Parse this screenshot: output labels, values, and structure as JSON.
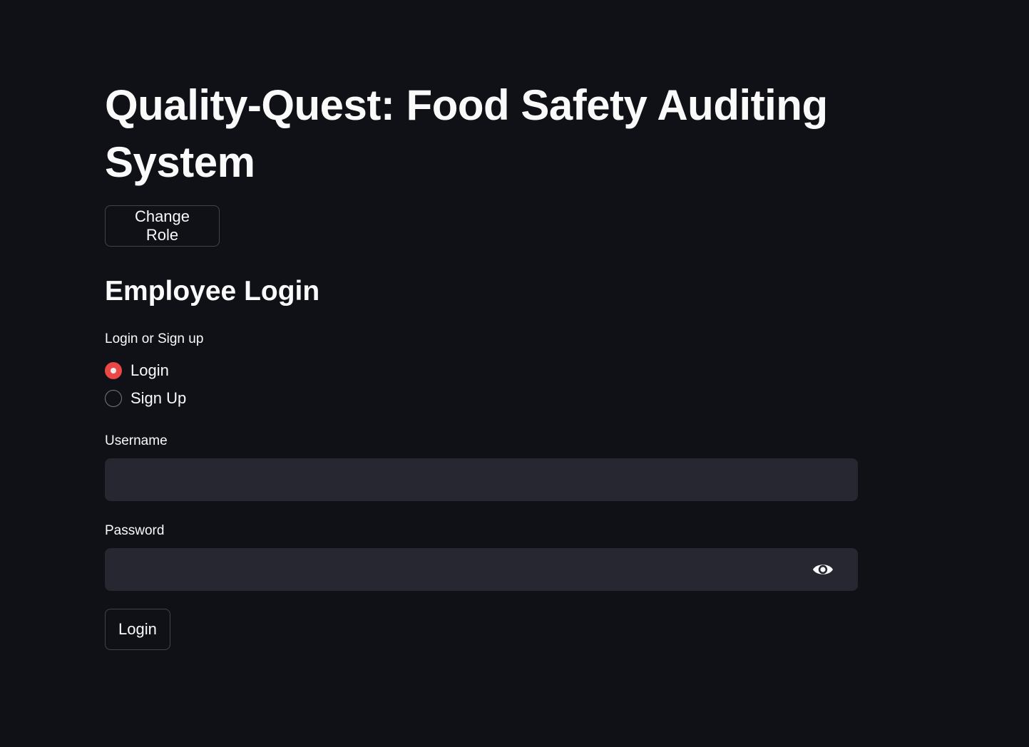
{
  "page": {
    "title": "Quality-Quest: Food Safety Auditing System",
    "change_role_label": "Change Role",
    "subheader": "Employee Login"
  },
  "auth_mode": {
    "label": "Login or Sign up",
    "options": [
      "Login",
      "Sign Up"
    ],
    "selected": "Login"
  },
  "username": {
    "label": "Username",
    "value": ""
  },
  "password": {
    "label": "Password",
    "value": "",
    "toggle_icon": "eye-icon"
  },
  "submit": {
    "label": "Login"
  },
  "colors": {
    "background": "#0f1117",
    "input_bg": "#262730",
    "accent": "#ff4b4b",
    "text": "#fafafa"
  }
}
